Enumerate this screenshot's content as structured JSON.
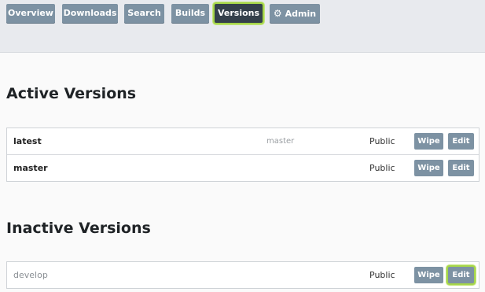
{
  "nav": {
    "items": [
      {
        "label": "Overview"
      },
      {
        "label": "Downloads"
      },
      {
        "label": "Search"
      },
      {
        "label": "Builds"
      },
      {
        "label": "Versions",
        "active": true
      },
      {
        "label": "Admin",
        "icon": "gear-icon"
      }
    ]
  },
  "active_versions": {
    "heading": "Active Versions",
    "rows": [
      {
        "name": "latest",
        "branch": "master",
        "privacy": "Public",
        "wipe": "Wipe",
        "edit": "Edit"
      },
      {
        "name": "master",
        "branch": "",
        "privacy": "Public",
        "wipe": "Wipe",
        "edit": "Edit"
      }
    ]
  },
  "inactive_versions": {
    "heading": "Inactive Versions",
    "rows": [
      {
        "name": "develop",
        "privacy": "Public",
        "wipe": "Wipe",
        "edit": "Edit"
      }
    ]
  },
  "colors": {
    "button": "#7d92a3",
    "active_button": "#34404b",
    "focus_ring": "#a6d64a"
  }
}
